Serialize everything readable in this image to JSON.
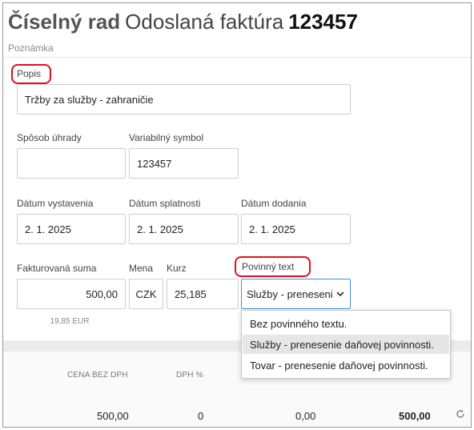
{
  "header": {
    "title_bold": "Číselný rad",
    "title_text": "Odoslaná faktúra",
    "title_number": "123457",
    "subtitle": "Poznámka"
  },
  "form": {
    "popis": {
      "label": "Popis",
      "value": "Tržby za služby - zahraničie"
    },
    "sposob_uhrady": {
      "label": "Spôsob úhrady",
      "value": ""
    },
    "variabilny_symbol": {
      "label": "Variabilný symbol",
      "value": "123457"
    },
    "datum_vystavenia": {
      "label": "Dátum vystavenia",
      "value": "2. 1. 2025"
    },
    "datum_splatnosti": {
      "label": "Dátum splatnosti",
      "value": "2. 1. 2025"
    },
    "datum_dodania": {
      "label": "Dátum dodania",
      "value": "2. 1. 2025"
    },
    "fakturovana_suma": {
      "label": "Fakturovaná suma",
      "value": "500,00",
      "sub_value": "19,85 EUR"
    },
    "mena": {
      "label": "Mena",
      "value": "CZK"
    },
    "kurz": {
      "label": "Kurz",
      "value": "25,185"
    },
    "povinny_text": {
      "label": "Povinný text",
      "value": "Služby - preneseni",
      "options": [
        "Bez povinného textu.",
        "Služby - prenesenie daňovej povinnosti.",
        "Tovar - prenesenie daňovej povinnosti."
      ],
      "active_option_index": 1
    }
  },
  "totals": {
    "headers": [
      "CENA BEZ DPH",
      "DPH %"
    ],
    "values": [
      "500,00",
      "0",
      "0,00",
      "500,00"
    ]
  },
  "colors": {
    "highlight": "#e0101e",
    "focus_border": "#4a90d9",
    "active_option": "#e6e6e6"
  },
  "icons": [
    "chevron-down-icon",
    "refresh-icon"
  ]
}
